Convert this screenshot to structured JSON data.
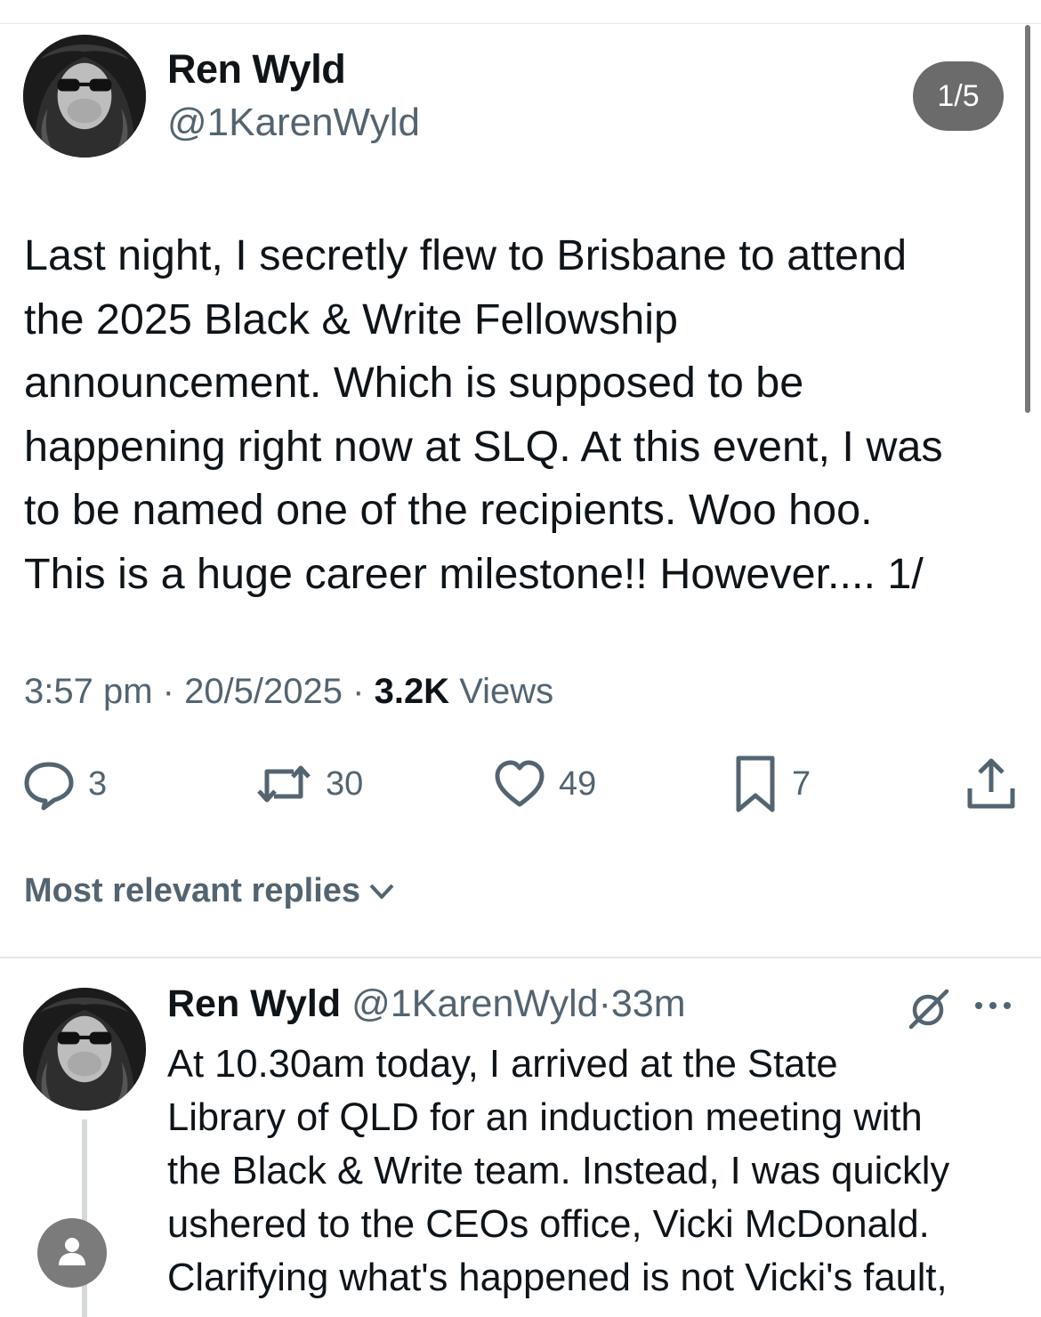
{
  "tweet": {
    "author_name": "Ren Wyld",
    "author_handle": "@1KarenWyld",
    "thread_counter": "1/5",
    "text": "Last  night, I secretly flew to Brisbane to attend\nthe 2025 Black & Write Fellowship\nannouncement. Which is supposed to be\nhappening right now at SLQ. At this event, I was\nto be named one of the recipients. Woo hoo.\nThis is a huge career milestone!! However.... 1/",
    "time": "3:57 pm",
    "date": "20/5/2025",
    "views_count": "3.2K",
    "views_label": "Views",
    "separator": " · "
  },
  "actions": {
    "replies": "3",
    "reposts": "30",
    "likes": "49",
    "bookmarks": "7"
  },
  "replies_section": {
    "sort_label": "Most relevant replies"
  },
  "reply": {
    "author_name": "Ren Wyld",
    "author_handle": "@1KarenWyld",
    "time": "33m",
    "separator": "·",
    "text": "At 10.30am today, I arrived at the State\nLibrary of QLD for an induction meeting with\nthe Black & Write team. Instead, I was quickly\nushered to the CEOs office, Vicki McDonald.\nClarifying what's happened is not Vicki's fault,"
  },
  "colors": {
    "text_primary": "#0f1419",
    "text_secondary": "#536471",
    "counter_bg": "#6b6b6b",
    "divider": "#e6e6e6"
  },
  "icons": [
    "reply-icon",
    "repost-icon",
    "like-icon",
    "bookmark-icon",
    "share-icon",
    "chevron-down-icon",
    "grok-icon",
    "more-icon",
    "default-user-icon"
  ]
}
